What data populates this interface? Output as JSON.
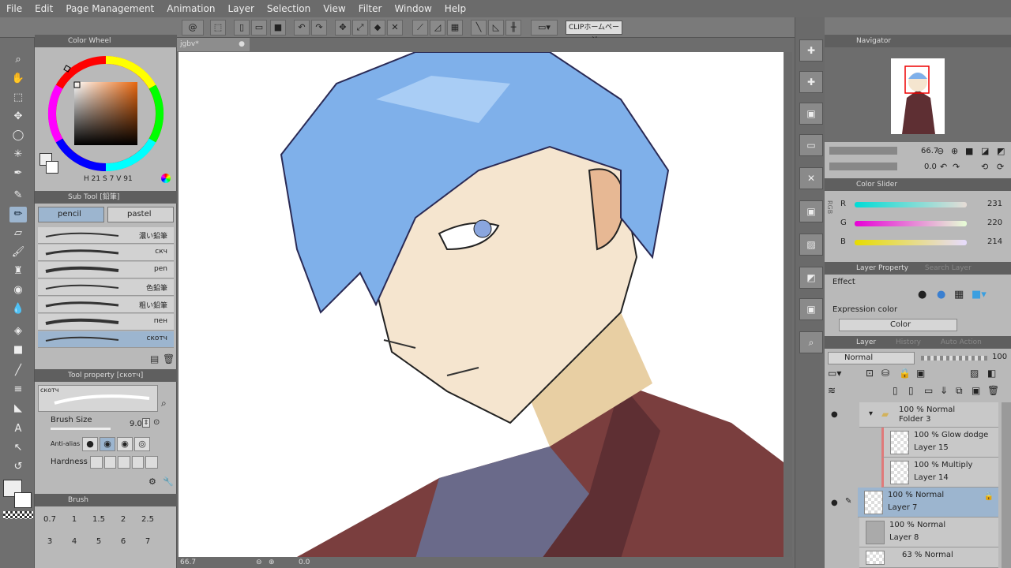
{
  "menu": [
    "File",
    "Edit",
    "Page Management",
    "Animation",
    "Layer",
    "Selection",
    "View",
    "Filter",
    "Window",
    "Help"
  ],
  "toolbar": {
    "clip_label": "CLIPホームページ"
  },
  "document": {
    "tab_title": "jgbv*",
    "zoom": "66.7",
    "angle": "0.0"
  },
  "color_wheel": {
    "title": "Color Wheel",
    "h_label": "H",
    "h": "21",
    "s_label": "S",
    "s": "7",
    "v_label": "V",
    "v": "91"
  },
  "sub_tool": {
    "title": "Sub Tool [鉛筆]",
    "tabs": [
      "pencil",
      "pastel"
    ],
    "strokes": [
      "濃い鉛筆",
      "скч",
      "pen",
      "色鉛筆",
      "粗い鉛筆",
      "пен",
      "скотч"
    ]
  },
  "tool_property": {
    "title": "Tool property [скотч]",
    "preview_label": "скотч",
    "brush_size_label": "Brush Size",
    "brush_size_value": "9.0",
    "anti_alias_label": "Anti-alias",
    "hardness_label": "Hardness"
  },
  "brush_size_panel": {
    "title": "Brush",
    "row1": [
      "0.7",
      "1",
      "1.5",
      "2",
      "2.5"
    ],
    "row2": [
      "3",
      "4",
      "5",
      "6",
      "7"
    ]
  },
  "navigator": {
    "title": "Navigator",
    "zoom": "66.7",
    "angle": "0.0"
  },
  "color_slider": {
    "title": "Color Slider",
    "r_label": "R",
    "r": "231",
    "g_label": "G",
    "g": "220",
    "b_label": "B",
    "b": "214",
    "mode_tab": "RGB"
  },
  "layer_property": {
    "title": "Layer Property",
    "tab2": "Search Layer",
    "effect_label": "Effect",
    "expression_label": "Expression color",
    "expression_value": "Color"
  },
  "layer_panel": {
    "title": "Layer",
    "tab2": "History",
    "tab3": "Auto Action",
    "blend_mode": "Normal",
    "opacity": "100",
    "folder": {
      "mode": "100 %  Normal",
      "name": "Folder 3"
    },
    "layers": [
      {
        "mode": "100 %  Glow dodge",
        "name": "Layer 15"
      },
      {
        "mode": "100 %  Multiply",
        "name": "Layer 14"
      },
      {
        "mode": "100 %  Normal",
        "name": "Layer 7"
      },
      {
        "mode": "100 %  Normal",
        "name": "Layer 8"
      },
      {
        "mode": "63 %  Normal",
        "name": ""
      }
    ]
  },
  "colors": {
    "accent": "#9cb5cf",
    "panel": "#b9b9b9",
    "hair": "#7fb0ea",
    "skin": "#f5e5cf",
    "robe": "#7a3e3e"
  }
}
